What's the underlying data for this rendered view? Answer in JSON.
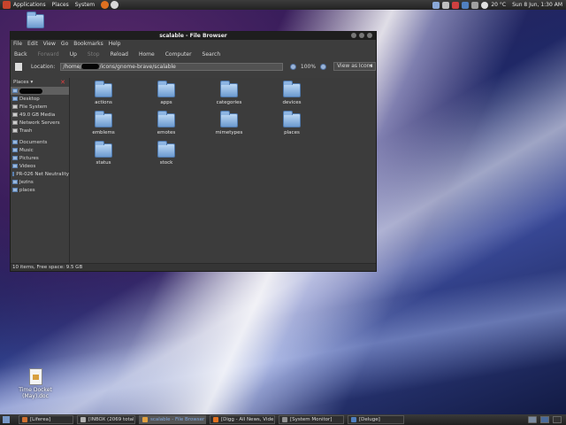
{
  "top_panel": {
    "menus": [
      "Applications",
      "Places",
      "System"
    ],
    "weather": "20 °C",
    "clock": "Sun 8 Jun,  1:30 AM"
  },
  "desktop": {
    "doc_icon_label": "Time Docket (May).doc"
  },
  "window": {
    "title": "scalable - File Browser",
    "menu": [
      "File",
      "Edit",
      "View",
      "Go",
      "Bookmarks",
      "Help"
    ],
    "toolbar": {
      "back": "Back",
      "forward": "Forward",
      "up": "Up",
      "stop": "Stop",
      "reload": "Reload",
      "home": "Home",
      "computer": "Computer",
      "search": "Search"
    },
    "location": {
      "label": "Location:",
      "path_start": "/home/",
      "path_end": "/icons/gnome-brave/scalable",
      "zoom": "100%",
      "view_mode": "View as Icons"
    },
    "sidebar": {
      "header": "Places",
      "items": [
        {
          "label": "",
          "icon": "home-folder-icon",
          "redacted": true
        },
        {
          "label": "Desktop",
          "icon": "desktop-icon"
        },
        {
          "label": "File System",
          "icon": "drive-icon"
        },
        {
          "label": "49.0 GB Media",
          "icon": "drive-icon"
        },
        {
          "label": "Network Servers",
          "icon": "network-icon"
        },
        {
          "label": "Trash",
          "icon": "trash-icon"
        },
        {
          "label": "Documents",
          "icon": "folder-icon"
        },
        {
          "label": "Music",
          "icon": "folder-icon"
        },
        {
          "label": "Pictures",
          "icon": "folder-icon"
        },
        {
          "label": "Videos",
          "icon": "folder-icon"
        },
        {
          "label": "PR-026 Net Neutrality",
          "icon": "folder-icon"
        },
        {
          "label": "Jezins",
          "icon": "folder-icon"
        },
        {
          "label": "places",
          "icon": "folder-icon"
        }
      ]
    },
    "files": [
      "actions",
      "apps",
      "categories",
      "devices",
      "emblems",
      "emotes",
      "mimetypes",
      "places",
      "status",
      "stock"
    ],
    "status": "10 items, Free space: 9.5 GB"
  },
  "taskbar": {
    "tasks": [
      {
        "label": "[Liferea]",
        "active": false
      },
      {
        "label": "[INBOX (2069 total) - ...",
        "active": false
      },
      {
        "label": "scalable - File Browser",
        "active": true
      },
      {
        "label": "[Digg - All News, Vide...",
        "active": false
      },
      {
        "label": "[System Monitor]",
        "active": false
      },
      {
        "label": "[Deluge]",
        "active": false
      }
    ]
  }
}
